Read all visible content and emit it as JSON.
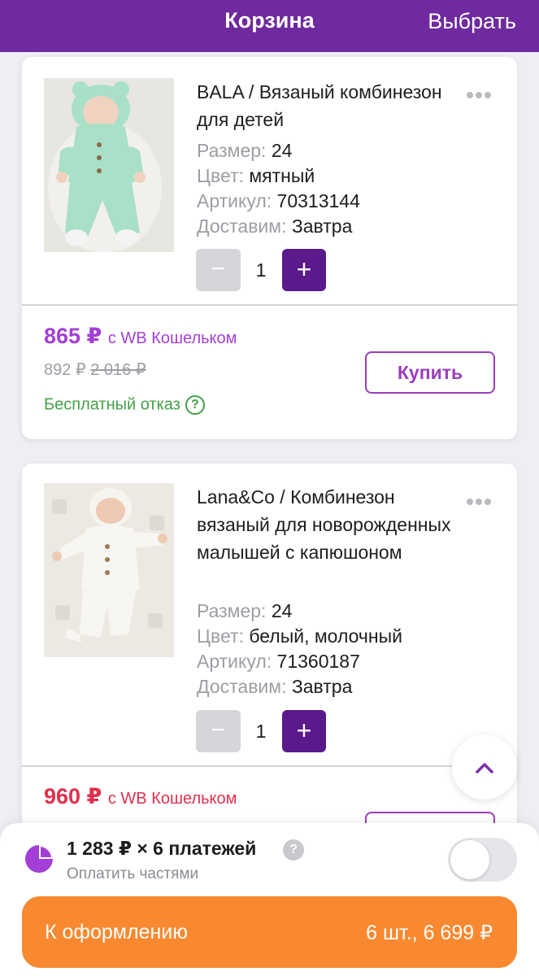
{
  "header": {
    "title": "Корзина",
    "select_label": "Выбрать"
  },
  "items": [
    {
      "name": "BALA / Вязаный комбинезон для детей",
      "attrs": [
        {
          "k": "Размер:",
          "v": "24"
        },
        {
          "k": "Цвет:",
          "v": "мятный"
        },
        {
          "k": "Артикул:",
          "v": "70313144"
        },
        {
          "k": "Доставим:",
          "v": "Завтра"
        }
      ],
      "qty": "1",
      "minus": "−",
      "plus": "+",
      "price": "865 ₽",
      "price_suffix": "с WB Кошельком",
      "price_color": "#a33fd6",
      "price_alt": "892 ₽",
      "price_old": "2 016 ₽",
      "free_cancel": "Бесплатный отказ",
      "free_cancel_icon": "?",
      "buy_label": "Купить"
    },
    {
      "name": "Lana&Co / Комбинезон вязаный для новорожденных малышей с капюшоном",
      "attrs": [
        {
          "k": "Размер:",
          "v": "24"
        },
        {
          "k": "Цвет:",
          "v": "белый, молочный"
        },
        {
          "k": "Артикул:",
          "v": "71360187"
        },
        {
          "k": "Доставим:",
          "v": "Завтра"
        }
      ],
      "qty": "1",
      "minus": "−",
      "plus": "+",
      "price": "960 ₽",
      "price_suffix": "с WB Кошельком",
      "price_color": "#e0304e"
    }
  ],
  "installments": {
    "amount": "1 283 ₽ × 6 платежей",
    "help": "?",
    "subtitle": "Оплатить частями",
    "toggle_on": false
  },
  "checkout": {
    "label": "К оформлению",
    "total": "6 шт., 6 699 ₽"
  },
  "icons": {
    "scroll_top": "chevron-up-icon",
    "more": "more-dots-icon",
    "pie": "pie-chart-icon"
  },
  "colors": {
    "header": "#6e2a9e",
    "checkout": "#f88930",
    "accent": "#9b3dbb",
    "plus": "#5a1a8c",
    "success": "#43a047"
  }
}
